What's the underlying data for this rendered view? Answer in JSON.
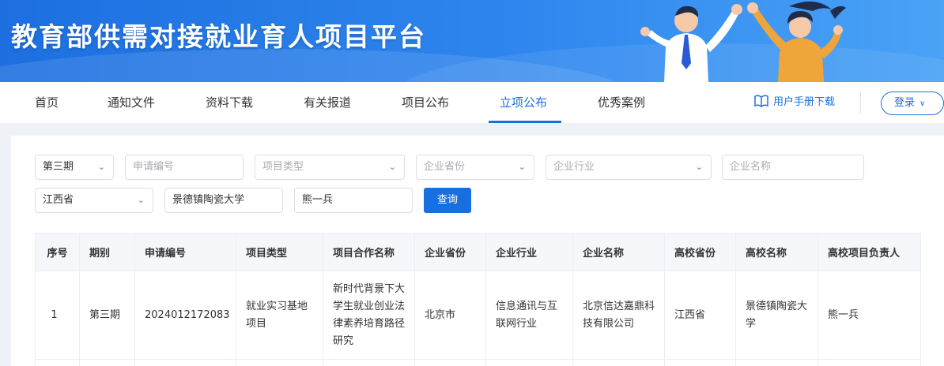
{
  "header": {
    "title": "教育部供需对接就业育人项目平台"
  },
  "nav": {
    "items": [
      {
        "label": "首页"
      },
      {
        "label": "通知文件"
      },
      {
        "label": "资料下载"
      },
      {
        "label": "有关报道"
      },
      {
        "label": "项目公布"
      },
      {
        "label": "立项公布"
      },
      {
        "label": "优秀案例"
      }
    ],
    "active": "立项公布",
    "manual_label": "用户手册下载",
    "login_label": "登录"
  },
  "filters": {
    "period": {
      "value": "第三期"
    },
    "application_no": {
      "placeholder": "申请编号"
    },
    "project_type": {
      "placeholder": "项目类型"
    },
    "company_province": {
      "placeholder": "企业省份"
    },
    "company_industry": {
      "placeholder": "企业行业"
    },
    "company_name": {
      "placeholder": "企业名称"
    },
    "school_province": {
      "value": "江西省"
    },
    "school_name": {
      "value": "景德镇陶瓷大学"
    },
    "leader": {
      "value": "熊一兵"
    },
    "query_label": "查询"
  },
  "table": {
    "headers": [
      "序号",
      "期别",
      "申请编号",
      "项目类型",
      "项目合作名称",
      "企业省份",
      "企业行业",
      "企业名称",
      "高校省份",
      "高校名称",
      "高校项目负责人"
    ],
    "rows": [
      {
        "index": "1",
        "period": "第三期",
        "application_no": "2024012172083",
        "project_type": "就业实习基地项目",
        "project_name": "新时代背景下大学生就业创业法律素养培育路径研究",
        "company_province": "北京市",
        "company_industry": "信息通讯与互联网行业",
        "company_name": "北京信达嘉鼎科技有限公司",
        "school_province": "江西省",
        "school_name": "景德镇陶瓷大学",
        "leader": "熊一兵"
      }
    ]
  },
  "colors": {
    "brand": "#1a6fe0",
    "banner_start": "#1d6fe0",
    "banner_end": "#4aa3f6"
  }
}
